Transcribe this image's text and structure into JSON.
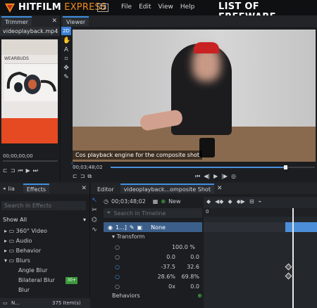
{
  "app": {
    "name_prefix": "HITFILM",
    "name_suffix": "EXPRESS",
    "version": "12"
  },
  "menu": [
    "File",
    "Edit",
    "View",
    "Help"
  ],
  "watermark": "LIST OF FREEWARE",
  "trimmer": {
    "tab": "Trimmer",
    "file": "videoplayback.mp4",
    "product_label": "WEARBUDS",
    "timecode": "00;00;00;00"
  },
  "viewer": {
    "tab": "Viewer",
    "mode": "2D",
    "caption": "Cos playback engine for the composite shot",
    "timecode": "00;03;48;02"
  },
  "left_panel": {
    "tab_media": "lia",
    "tab_effects": "Effects",
    "search_placeholder": "Search in Effects",
    "show_all": "Show All",
    "items": [
      {
        "label": "360° Video",
        "indent": 1,
        "open": false,
        "badge": ""
      },
      {
        "label": "Audio",
        "indent": 1,
        "open": false,
        "badge": ""
      },
      {
        "label": "Behavior",
        "indent": 1,
        "open": false,
        "badge": ""
      },
      {
        "label": "Blurs",
        "indent": 1,
        "open": true,
        "badge": ""
      },
      {
        "label": "Angle Blur",
        "indent": 2,
        "open": null,
        "badge": ""
      },
      {
        "label": "Bilateral Blur",
        "indent": 2,
        "open": null,
        "badge": "30+"
      },
      {
        "label": "Blur",
        "indent": 2,
        "open": null,
        "badge": ""
      }
    ],
    "footer_label": "N...",
    "item_count": "375 Item(s)"
  },
  "editor": {
    "tab_editor": "Editor",
    "tab_shot": "videoplayback...omposite Shot",
    "timecode": "00;03;48;02",
    "search_placeholder": "Search in Timeline",
    "layer_name": "1...]",
    "blend": "None",
    "transform": "Transform",
    "props": [
      {
        "a": "100.0 %",
        "b": ""
      },
      {
        "a": "0.0",
        "b": "0.0"
      },
      {
        "a": "-37.5",
        "b": "32.6"
      },
      {
        "a": "28.6%",
        "b": "69.8%"
      },
      {
        "a": "0x",
        "b": "0.0"
      }
    ],
    "behaviors": "Behaviors",
    "ruler_start": "0"
  }
}
